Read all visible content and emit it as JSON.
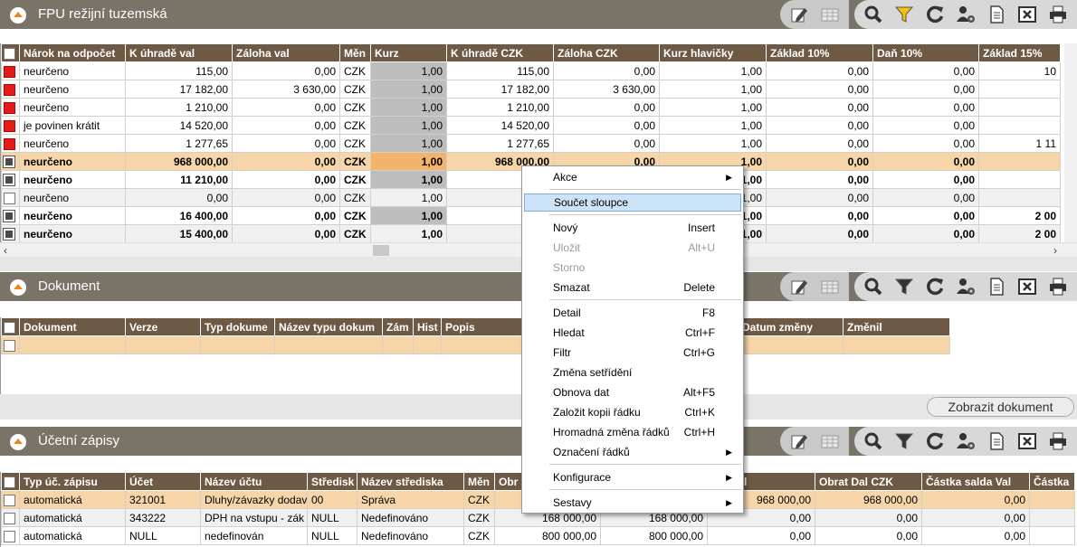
{
  "panels": {
    "fpu": {
      "title": "FPU režijní tuzemská"
    },
    "dokument": {
      "title": "Dokument",
      "button": "Zobrazit dokument"
    },
    "ucetni": {
      "title": "Účetní zápisy"
    }
  },
  "fpu_grid": {
    "headers": [
      "Nárok na odpočet",
      "K úhradě val",
      "Záloha val",
      "Měn",
      "Kurz",
      "K úhradě CZK",
      "Záloha CZK",
      "Kurz hlavičky",
      "Základ 10%",
      "Daň 10%",
      "Základ 15%"
    ],
    "rows": [
      {
        "chk": "red",
        "cells": [
          "neurčeno",
          "115,00",
          "0,00",
          "CZK",
          "1,00",
          "115,00",
          "0,00",
          "1,00",
          "0,00",
          "0,00",
          "10"
        ]
      },
      {
        "chk": "red",
        "cells": [
          "neurčeno",
          "17 182,00",
          "3 630,00",
          "CZK",
          "1,00",
          "17 182,00",
          "3 630,00",
          "1,00",
          "0,00",
          "0,00",
          ""
        ]
      },
      {
        "chk": "red",
        "cells": [
          "neurčeno",
          "1 210,00",
          "0,00",
          "CZK",
          "1,00",
          "1 210,00",
          "0,00",
          "1,00",
          "0,00",
          "0,00",
          ""
        ]
      },
      {
        "chk": "red",
        "cells": [
          "je povinen krátit",
          "14 520,00",
          "0,00",
          "CZK",
          "1,00",
          "14 520,00",
          "0,00",
          "1,00",
          "0,00",
          "0,00",
          ""
        ]
      },
      {
        "chk": "red",
        "cells": [
          "neurčeno",
          "1 277,65",
          "0,00",
          "CZK",
          "1,00",
          "1 277,65",
          "0,00",
          "1,00",
          "0,00",
          "0,00",
          "1 11"
        ]
      },
      {
        "chk": "dark",
        "cls": "bold sel",
        "cells": [
          "neurčeno",
          "968 000,00",
          "0,00",
          "CZK",
          "1,00",
          "968 000,00",
          "0,00",
          "1,00",
          "0,00",
          "0,00",
          ""
        ]
      },
      {
        "chk": "dark",
        "cls": "bold",
        "cells": [
          "neurčeno",
          "11 210,00",
          "0,00",
          "CZK",
          "1,00",
          "11 2",
          "",
          "1,00",
          "0,00",
          "0,00",
          ""
        ]
      },
      {
        "chk": "empty",
        "cls": "alt",
        "cells": [
          "neurčeno",
          "0,00",
          "0,00",
          "CZK",
          "1,00",
          "",
          "",
          "1,00",
          "0,00",
          "0,00",
          ""
        ]
      },
      {
        "chk": "dark",
        "cls": "bold",
        "cells": [
          "neurčeno",
          "16 400,00",
          "0,00",
          "CZK",
          "1,00",
          "16 4",
          "",
          "1,00",
          "0,00",
          "0,00",
          "2 00"
        ]
      },
      {
        "chk": "dark",
        "cls": "bold alt",
        "cells": [
          "neurčeno",
          "15 400,00",
          "0,00",
          "CZK",
          "1,00",
          "15 4",
          "",
          "1,00",
          "0,00",
          "0,00",
          "2 00"
        ]
      }
    ]
  },
  "dok_grid": {
    "headers": [
      "Dokument",
      "Verze",
      "Typ dokume",
      "Název typu dokum",
      "Zám",
      "Hist",
      "Popis",
      "",
      "Datum změny",
      "Změnil"
    ]
  },
  "uz_grid": {
    "headers": [
      "Typ úč. zápisu",
      "Účet",
      "Název účtu",
      "Středisk",
      "Název střediska",
      "Měn",
      "Obr",
      "",
      "Dal Val",
      "Obrat Dal CZK",
      "Částka salda Val",
      "Částka"
    ],
    "rows": [
      {
        "cls": "sel",
        "cells": [
          "automatická",
          "321001",
          "Dluhy/závazky dodav",
          "00",
          "Správa",
          "CZK",
          "",
          "",
          "968 000,00",
          "968 000,00",
          "0,00",
          ""
        ]
      },
      {
        "cls": "alt",
        "cells": [
          "automatická",
          "343222",
          "DPH na vstupu - zák",
          "NULL",
          "Nedefinováno",
          "CZK",
          "168 000,00",
          "168 000,00",
          "0,00",
          "0,00",
          "0,00",
          ""
        ]
      },
      {
        "cls": "",
        "cells": [
          "automatická",
          "NULL",
          "nedefinován",
          "NULL",
          "Nedefinováno",
          "CZK",
          "800 000,00",
          "800 000,00",
          "0,00",
          "0,00",
          "0,00",
          ""
        ]
      }
    ]
  },
  "context_menu": {
    "items": [
      {
        "label": "Akce",
        "submenu": true
      },
      {
        "label": "Součet sloupce",
        "highlight": true
      },
      {
        "label": "Nový",
        "shortcut": "Insert"
      },
      {
        "label": "Uložit",
        "shortcut": "Alt+U",
        "disabled": true
      },
      {
        "label": "Storno",
        "disabled": true
      },
      {
        "label": "Smazat",
        "shortcut": "Delete"
      },
      {
        "label": "Detail",
        "shortcut": "F8"
      },
      {
        "label": "Hledat",
        "shortcut": "Ctrl+F"
      },
      {
        "label": "Filtr",
        "shortcut": "Ctrl+G"
      },
      {
        "label": "Změna setřídění"
      },
      {
        "label": "Obnova dat",
        "shortcut": "Alt+F5"
      },
      {
        "label": "Založit kopii řádku",
        "shortcut": "Ctrl+K"
      },
      {
        "label": "Hromadná změna řádků",
        "shortcut": "Ctrl+H"
      },
      {
        "label": "Označení řádků",
        "submenu": true
      },
      {
        "label": "Konfigurace",
        "submenu": true
      },
      {
        "label": "Sestavy",
        "submenu": true
      }
    ]
  },
  "icons": [
    "edit-icon",
    "grid-icon",
    "search-icon",
    "filter-icon",
    "refresh-icon",
    "user-settings-icon",
    "document-icon",
    "excel-icon",
    "print-icon"
  ],
  "colors": {
    "header_bar": "#7a7468",
    "column_header": "#6e5a44",
    "selected_row": "#f6d6a8",
    "filter_active": "#f5c400"
  }
}
